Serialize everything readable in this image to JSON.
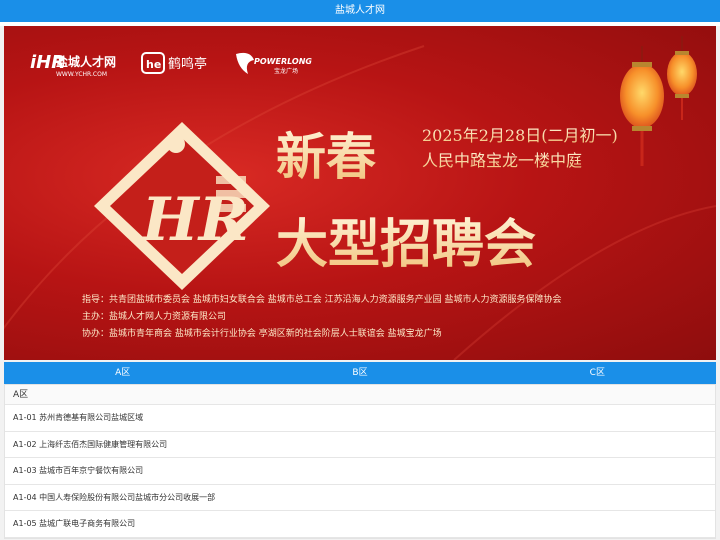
{
  "header": {
    "title": "盐城人才网"
  },
  "banner": {
    "logo_ychr_text": "盐城人才网",
    "logo_ychr_url": "WWW.YCHR.COM",
    "logo_he_text": "鹤鸣亭",
    "logo_powerlong_text": "POWERLONG",
    "logo_powerlong_sub": "宝龙广场",
    "headline_1": "新春",
    "headline_2": "大型招聘会",
    "date_line": "2025年2月28日(二月初一)",
    "venue_line": "人民中路宝龙一楼中庭",
    "guide_line": "指导：共青团盐城市委员会    盐城市妇女联合会    盐城市总工会    江苏沿海人力资源服务产业园    盐城市人力资源服务保障协会",
    "host_line": "主办：盐城人才网人力资源有限公司",
    "co_line": "协办：盐城市青年商会    盐城市会计行业协会      亭湖区新的社会阶层人士联谊会           盐城宝龙广场"
  },
  "tabs": [
    {
      "label": "A区"
    },
    {
      "label": "B区"
    },
    {
      "label": "C区"
    }
  ],
  "section": {
    "header": "A区",
    "items": [
      "A1-01 苏州肯德基有限公司盐城区域",
      "A1-02 上海纤志佰杰国际健康管理有限公司",
      "A1-03 盐城市百年京宁餐饮有限公司",
      "A1-04 中国人寿保险股份有限公司盐城市分公司收展一部",
      "A1-05 盐城广联电子商务有限公司"
    ]
  },
  "colors": {
    "accent": "#1a8fe8",
    "banner_red": "#b71414",
    "gold": "#f6d7a0"
  }
}
